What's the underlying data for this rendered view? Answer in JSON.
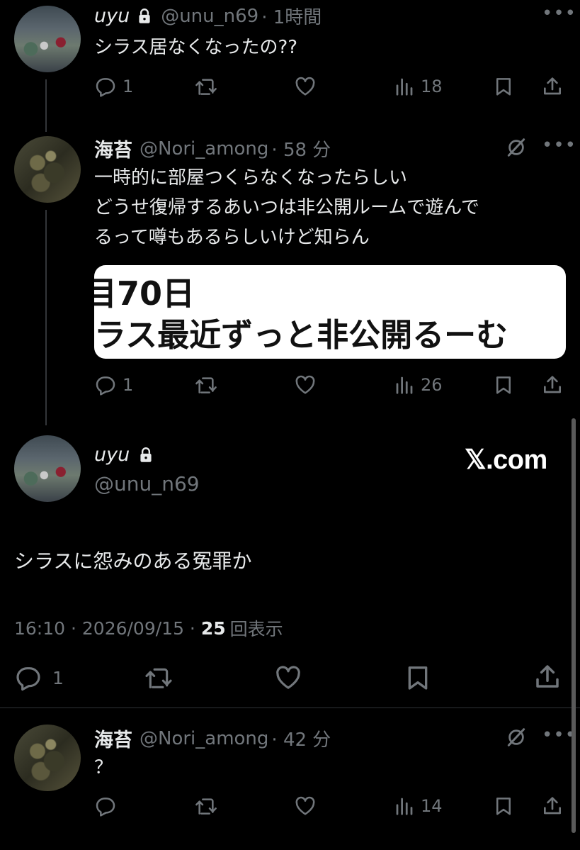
{
  "tweet1": {
    "display_name": "uyu",
    "handle": "@unu_n69",
    "time": "· 1時間",
    "text": "シラス居なくなったの??",
    "replies": "1",
    "views": "18"
  },
  "tweet2": {
    "display_name": "海苔",
    "handle": "@Nori_among",
    "time": "· 58 分",
    "lines": [
      "一時的に部屋つくらなくなったらしい",
      "どうせ復帰するあいつは非公開ルームで遊んで",
      "るって噂もあるらしいけど知らん"
    ],
    "embed_line1": "目70日",
    "embed_line2": "ラス最近ずっと非公開るーむ",
    "replies": "1",
    "views": "26"
  },
  "main_tweet": {
    "display_name": "uyu",
    "handle": "@unu_n69",
    "text": "シラスに怨みのある冤罪か",
    "timestamp": "16:10 · 2026/09/15 ·",
    "view_count": "25",
    "view_label": "回表示",
    "replies": "1",
    "watermark": "𝕏.com"
  },
  "tweet4": {
    "display_name": "海苔",
    "handle": "@Nori_among",
    "time": "· 42 分",
    "text": "？",
    "views": "14"
  },
  "icons": {
    "reply": "reply-icon",
    "retweet": "retweet-icon",
    "like": "heart-icon",
    "views": "views-icon",
    "bookmark": "bookmark-icon",
    "share": "share-icon",
    "lock": "lock-icon",
    "grok": "grok-icon",
    "more": "more-icon"
  },
  "colors": {
    "background": "#000000",
    "text": "#e7e9ea",
    "muted": "#71767b"
  }
}
